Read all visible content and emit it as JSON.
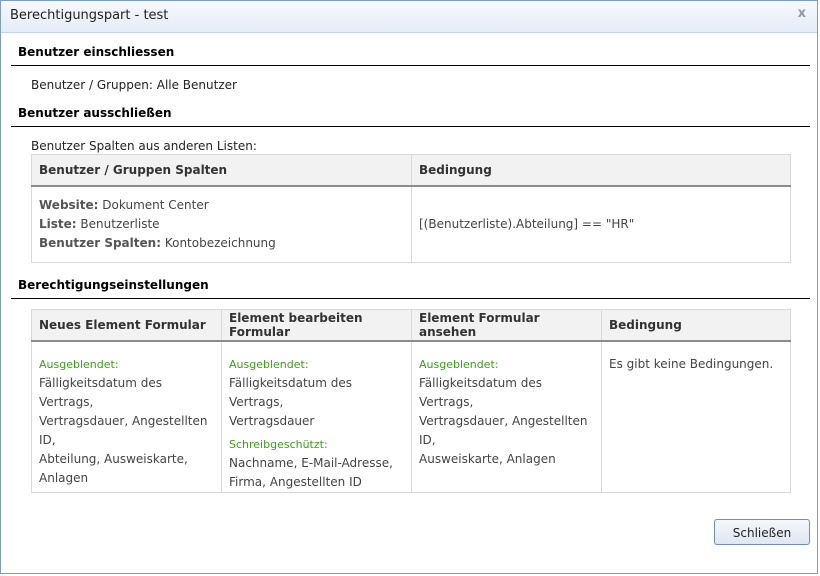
{
  "window": {
    "title": "Berechtigungspart - test",
    "close_label": "x"
  },
  "include": {
    "heading": "Benutzer einschliessen",
    "users_line": "Benutzer / Gruppen: Alle Benutzer"
  },
  "exclude": {
    "heading": "Benutzer ausschließen",
    "intro": "Benutzer Spalten aus anderen Listen:",
    "columns": [
      "Benutzer / Gruppen Spalten",
      "Bedingung"
    ],
    "website_label": "Website:",
    "website_value": "Dokument Center",
    "list_label": "Liste:",
    "list_value": "Benutzerliste",
    "cols_label": "Benutzer Spalten:",
    "cols_value": "Kontobezeichnung",
    "condition": "[(Benutzerliste).Abteilung] == \"HR\""
  },
  "settings": {
    "heading": "Berechtigungseinstellungen",
    "columns": [
      "Neues Element Formular",
      "Element bearbeiten Formular",
      "Element Formular ansehen",
      "Bedingung"
    ],
    "new_form": {
      "hidden_label": "Ausgeblendet:",
      "hidden_lines": [
        "Fälligkeitsdatum des Vertrags,",
        "Vertragsdauer, Angestellten ID,",
        "Abteilung, Ausweiskarte,",
        "Anlagen"
      ]
    },
    "edit_form": {
      "hidden_label": "Ausgeblendet:",
      "hidden_lines": [
        "Fälligkeitsdatum des Vertrags,",
        "Vertragsdauer"
      ],
      "readonly_label": "Schreibgeschützt:",
      "readonly_lines": [
        "Nachname, E-Mail-Adresse,",
        "Firma, Angestellten ID"
      ]
    },
    "view_form": {
      "hidden_label": "Ausgeblendet:",
      "hidden_lines": [
        "Fälligkeitsdatum des Vertrags,",
        "Vertragsdauer, Angestellten ID,",
        "Ausweiskarte, Anlagen"
      ]
    },
    "condition": "Es gibt keine Bedingungen."
  },
  "footer": {
    "close_button": "Schließen"
  }
}
